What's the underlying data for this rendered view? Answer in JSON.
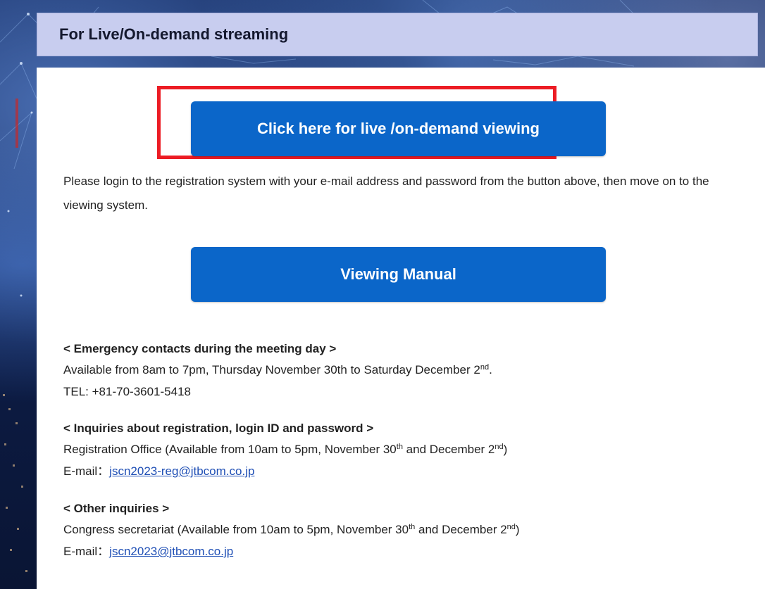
{
  "header": {
    "title": "For Live/On-demand streaming"
  },
  "buttons": {
    "live_label": "Click here for live /on-demand viewing",
    "manual_label": "Viewing Manual"
  },
  "intro": {
    "text": "Please login to the registration system with your e-mail address and password from the button above, then move on to the viewing system."
  },
  "emergency": {
    "title": "< Emergency contacts during the meeting day >",
    "availability": "Available from 8am to 7pm, Thursday November 30th to Saturday December 2",
    "availability_sup": "nd",
    "availability_end": ".",
    "tel": "TEL: +81-70-3601-5418"
  },
  "registration": {
    "title": "< Inquiries about registration, login ID and password >",
    "office_a": "Registration Office (Available from 10am to 5pm, November 30",
    "office_sup1": "th",
    "office_b": " and December 2",
    "office_sup2": "nd",
    "office_c": ")",
    "email_label": "E-mail：",
    "email": "jscn2023-reg@jtbcom.co.jp"
  },
  "other": {
    "title": "< Other inquiries >",
    "office_a": "Congress secretariat (Available from 10am to 5pm, November 30",
    "office_sup1": "th",
    "office_b": " and December 2",
    "office_sup2": "nd",
    "office_c": ")",
    "email_label": "E-mail：",
    "email": "jscn2023@jtbcom.co.jp"
  },
  "colors": {
    "header_bg": "#c8cdef",
    "button_bg": "#0b66c9",
    "highlight": "#ec1c24",
    "link": "#1f4fb5"
  }
}
